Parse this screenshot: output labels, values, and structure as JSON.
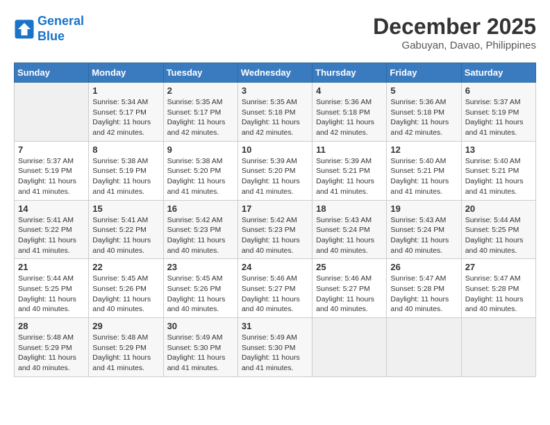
{
  "logo": {
    "line1": "General",
    "line2": "Blue"
  },
  "title": "December 2025",
  "subtitle": "Gabuyan, Davao, Philippines",
  "days_of_week": [
    "Sunday",
    "Monday",
    "Tuesday",
    "Wednesday",
    "Thursday",
    "Friday",
    "Saturday"
  ],
  "weeks": [
    [
      {
        "day": "",
        "info": ""
      },
      {
        "day": "1",
        "info": "Sunrise: 5:34 AM\nSunset: 5:17 PM\nDaylight: 11 hours\nand 42 minutes."
      },
      {
        "day": "2",
        "info": "Sunrise: 5:35 AM\nSunset: 5:17 PM\nDaylight: 11 hours\nand 42 minutes."
      },
      {
        "day": "3",
        "info": "Sunrise: 5:35 AM\nSunset: 5:18 PM\nDaylight: 11 hours\nand 42 minutes."
      },
      {
        "day": "4",
        "info": "Sunrise: 5:36 AM\nSunset: 5:18 PM\nDaylight: 11 hours\nand 42 minutes."
      },
      {
        "day": "5",
        "info": "Sunrise: 5:36 AM\nSunset: 5:18 PM\nDaylight: 11 hours\nand 42 minutes."
      },
      {
        "day": "6",
        "info": "Sunrise: 5:37 AM\nSunset: 5:19 PM\nDaylight: 11 hours\nand 41 minutes."
      }
    ],
    [
      {
        "day": "7",
        "info": "Sunrise: 5:37 AM\nSunset: 5:19 PM\nDaylight: 11 hours\nand 41 minutes."
      },
      {
        "day": "8",
        "info": "Sunrise: 5:38 AM\nSunset: 5:19 PM\nDaylight: 11 hours\nand 41 minutes."
      },
      {
        "day": "9",
        "info": "Sunrise: 5:38 AM\nSunset: 5:20 PM\nDaylight: 11 hours\nand 41 minutes."
      },
      {
        "day": "10",
        "info": "Sunrise: 5:39 AM\nSunset: 5:20 PM\nDaylight: 11 hours\nand 41 minutes."
      },
      {
        "day": "11",
        "info": "Sunrise: 5:39 AM\nSunset: 5:21 PM\nDaylight: 11 hours\nand 41 minutes."
      },
      {
        "day": "12",
        "info": "Sunrise: 5:40 AM\nSunset: 5:21 PM\nDaylight: 11 hours\nand 41 minutes."
      },
      {
        "day": "13",
        "info": "Sunrise: 5:40 AM\nSunset: 5:21 PM\nDaylight: 11 hours\nand 41 minutes."
      }
    ],
    [
      {
        "day": "14",
        "info": "Sunrise: 5:41 AM\nSunset: 5:22 PM\nDaylight: 11 hours\nand 41 minutes."
      },
      {
        "day": "15",
        "info": "Sunrise: 5:41 AM\nSunset: 5:22 PM\nDaylight: 11 hours\nand 40 minutes."
      },
      {
        "day": "16",
        "info": "Sunrise: 5:42 AM\nSunset: 5:23 PM\nDaylight: 11 hours\nand 40 minutes."
      },
      {
        "day": "17",
        "info": "Sunrise: 5:42 AM\nSunset: 5:23 PM\nDaylight: 11 hours\nand 40 minutes."
      },
      {
        "day": "18",
        "info": "Sunrise: 5:43 AM\nSunset: 5:24 PM\nDaylight: 11 hours\nand 40 minutes."
      },
      {
        "day": "19",
        "info": "Sunrise: 5:43 AM\nSunset: 5:24 PM\nDaylight: 11 hours\nand 40 minutes."
      },
      {
        "day": "20",
        "info": "Sunrise: 5:44 AM\nSunset: 5:25 PM\nDaylight: 11 hours\nand 40 minutes."
      }
    ],
    [
      {
        "day": "21",
        "info": "Sunrise: 5:44 AM\nSunset: 5:25 PM\nDaylight: 11 hours\nand 40 minutes."
      },
      {
        "day": "22",
        "info": "Sunrise: 5:45 AM\nSunset: 5:26 PM\nDaylight: 11 hours\nand 40 minutes."
      },
      {
        "day": "23",
        "info": "Sunrise: 5:45 AM\nSunset: 5:26 PM\nDaylight: 11 hours\nand 40 minutes."
      },
      {
        "day": "24",
        "info": "Sunrise: 5:46 AM\nSunset: 5:27 PM\nDaylight: 11 hours\nand 40 minutes."
      },
      {
        "day": "25",
        "info": "Sunrise: 5:46 AM\nSunset: 5:27 PM\nDaylight: 11 hours\nand 40 minutes."
      },
      {
        "day": "26",
        "info": "Sunrise: 5:47 AM\nSunset: 5:28 PM\nDaylight: 11 hours\nand 40 minutes."
      },
      {
        "day": "27",
        "info": "Sunrise: 5:47 AM\nSunset: 5:28 PM\nDaylight: 11 hours\nand 40 minutes."
      }
    ],
    [
      {
        "day": "28",
        "info": "Sunrise: 5:48 AM\nSunset: 5:29 PM\nDaylight: 11 hours\nand 40 minutes."
      },
      {
        "day": "29",
        "info": "Sunrise: 5:48 AM\nSunset: 5:29 PM\nDaylight: 11 hours\nand 41 minutes."
      },
      {
        "day": "30",
        "info": "Sunrise: 5:49 AM\nSunset: 5:30 PM\nDaylight: 11 hours\nand 41 minutes."
      },
      {
        "day": "31",
        "info": "Sunrise: 5:49 AM\nSunset: 5:30 PM\nDaylight: 11 hours\nand 41 minutes."
      },
      {
        "day": "",
        "info": ""
      },
      {
        "day": "",
        "info": ""
      },
      {
        "day": "",
        "info": ""
      }
    ]
  ]
}
